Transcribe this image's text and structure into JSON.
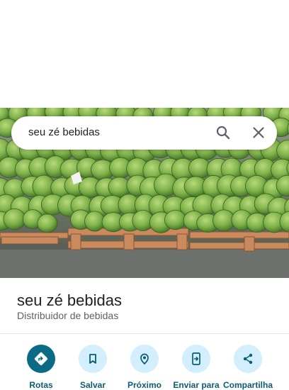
{
  "search": {
    "query": "seu zé bebidas",
    "search_icon": "search-icon",
    "clear_icon": "close-icon"
  },
  "place": {
    "name": "seu zé bebidas",
    "category": "Distribuidor de bebidas"
  },
  "actions": [
    {
      "label": "Rotas",
      "icon": "directions-icon"
    },
    {
      "label": "Salvar",
      "icon": "bookmark-icon"
    },
    {
      "label": "Próximo",
      "icon": "nearby-icon"
    },
    {
      "label": "Enviar para",
      "icon": "send-to-phone-icon"
    },
    {
      "label": "Compartilha",
      "icon": "share-icon"
    }
  ],
  "colors": {
    "primary_action": "#0b6b86",
    "action_background": "#d3eefc",
    "action_label": "#0b5c73"
  }
}
